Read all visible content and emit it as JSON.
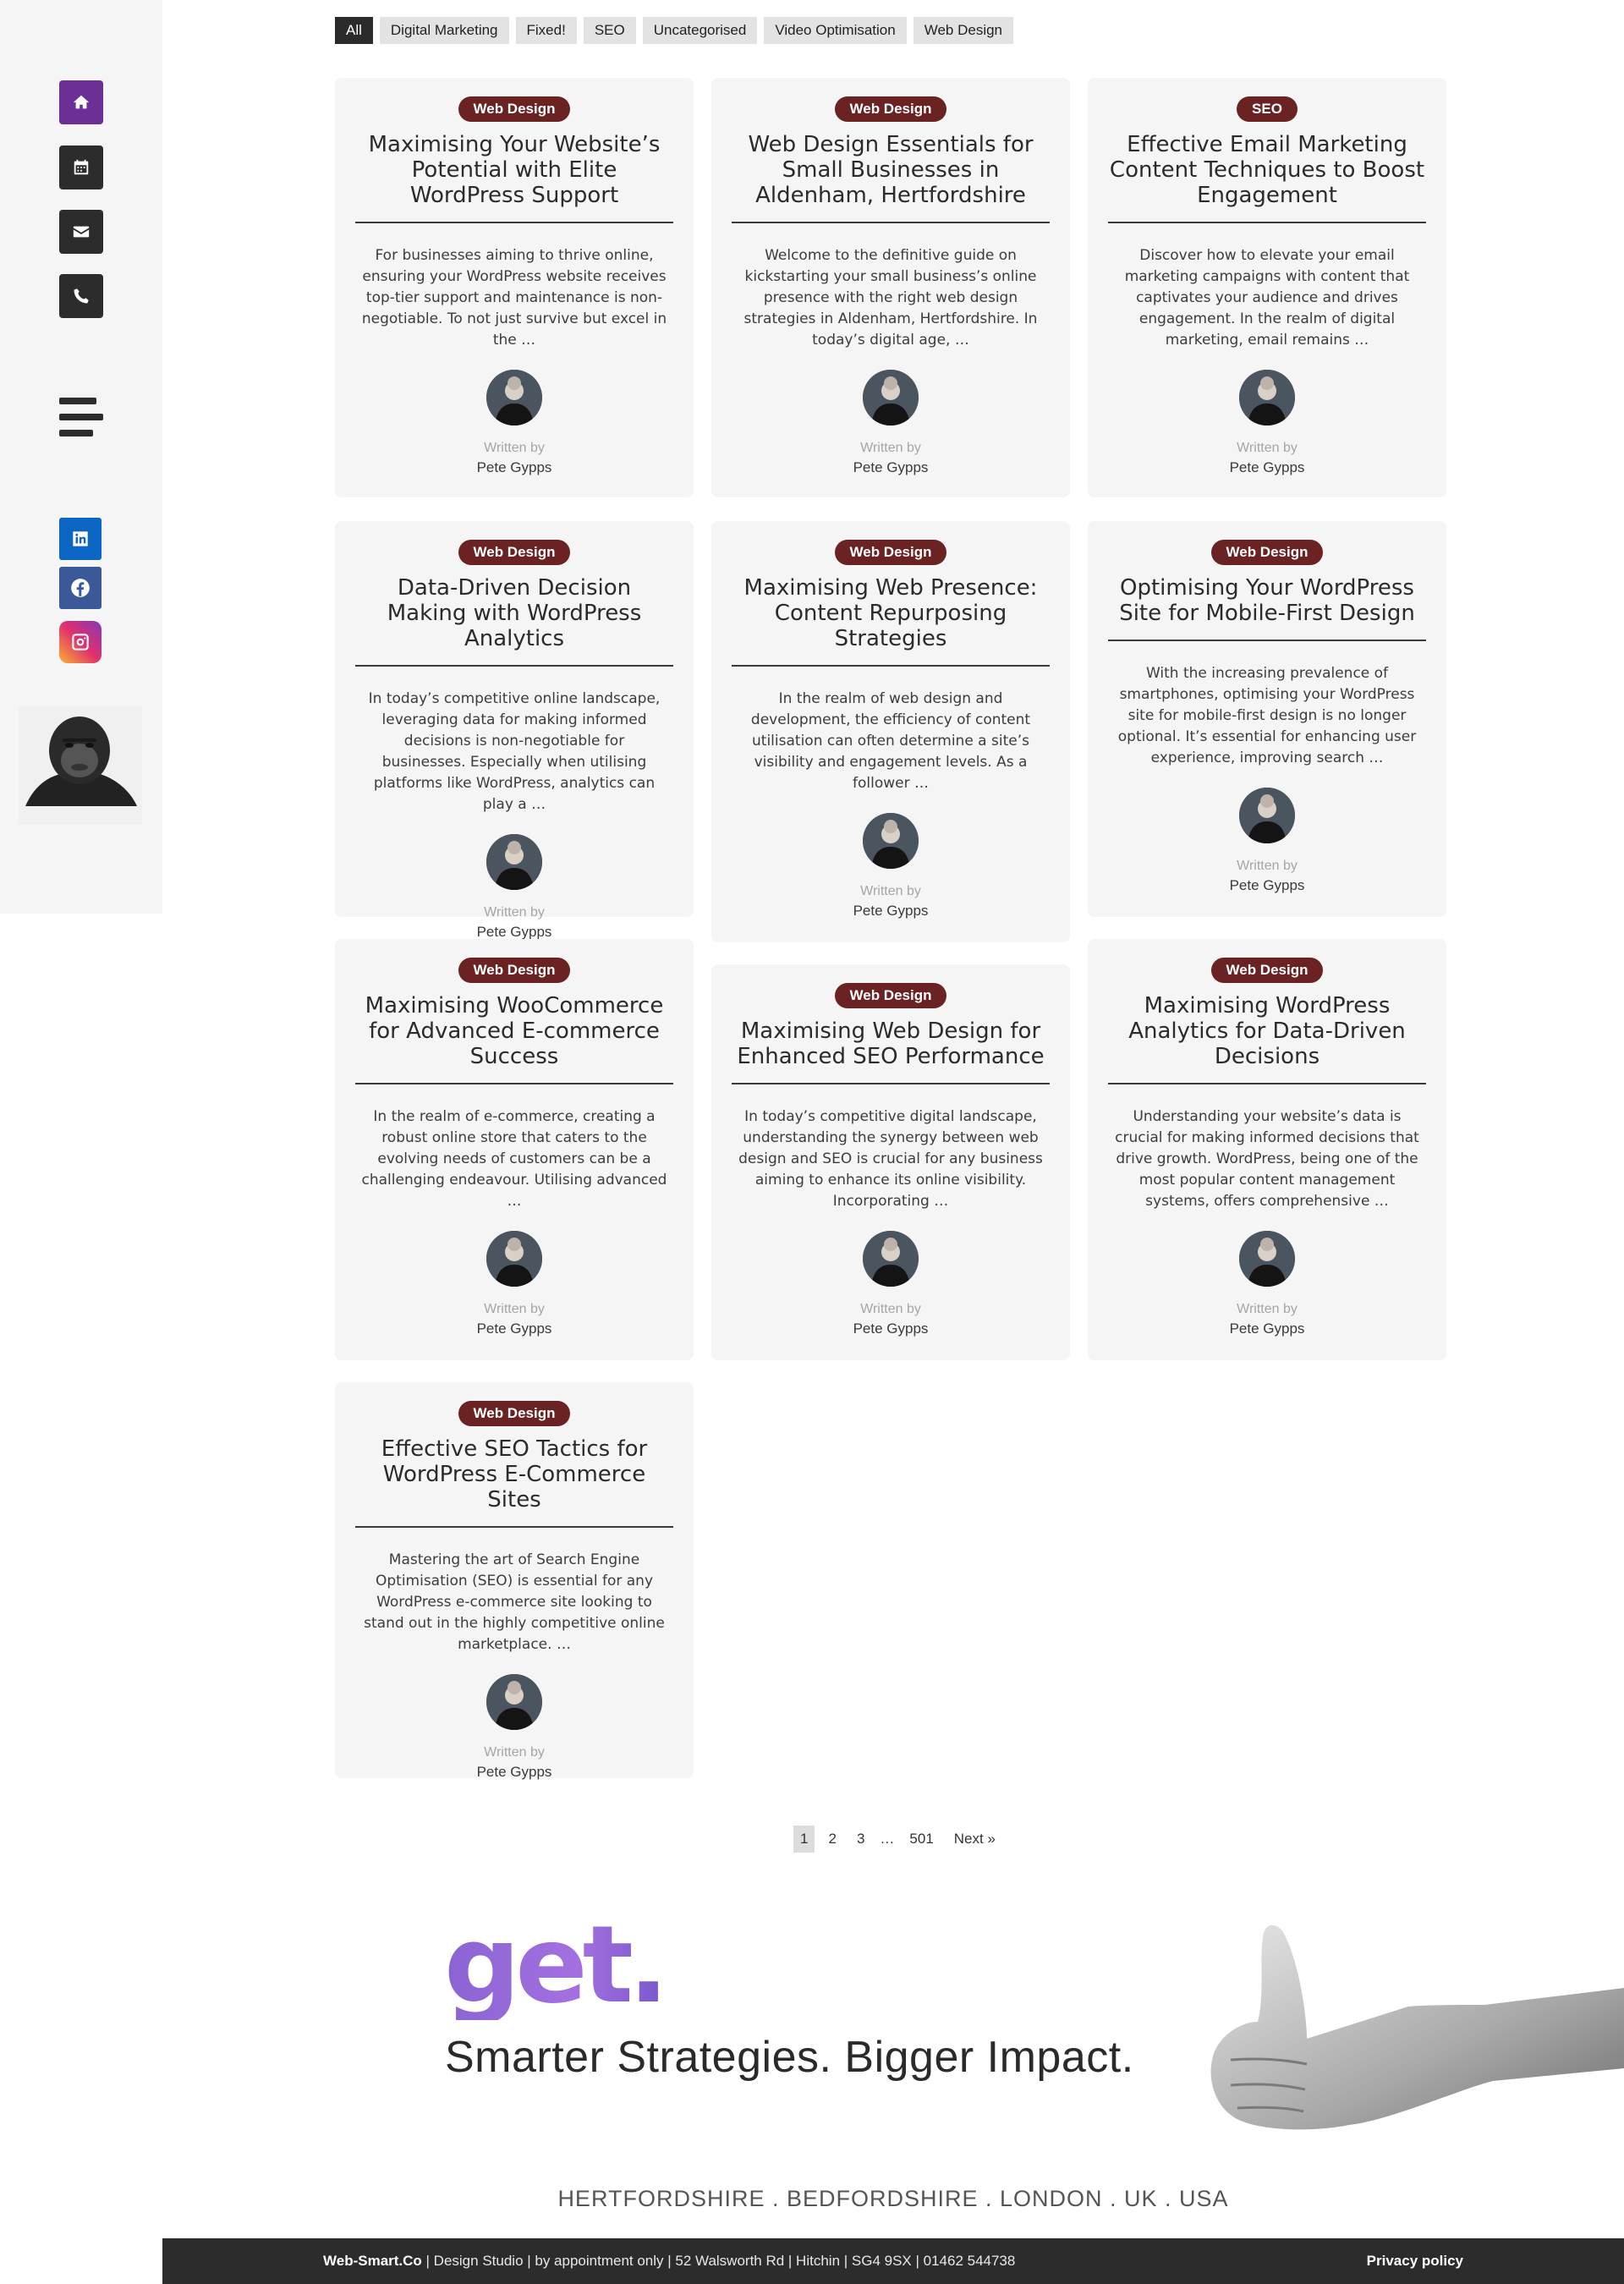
{
  "colors": {
    "home_button": "#6c2f96",
    "dark_button": "#2c2c2c",
    "linkedin": "#0a66c2",
    "facebook": "#3b5998",
    "badge": "#6a2222",
    "card_bg": "#f5f5f5",
    "footer_bg": "#2c2c2c"
  },
  "sidebar": {
    "buttons": [
      {
        "icon": "home-icon"
      },
      {
        "icon": "calendar-icon"
      },
      {
        "icon": "envelope-icon"
      },
      {
        "icon": "phone-icon"
      }
    ],
    "menu_icon": "hamburger-icon",
    "social": [
      {
        "icon": "linkedin-icon"
      },
      {
        "icon": "facebook-icon"
      },
      {
        "icon": "instagram-icon"
      }
    ],
    "mascot": "gorilla-mascot-image"
  },
  "filters": [
    "All",
    "Digital Marketing",
    "Fixed!",
    "SEO",
    "Uncategorised",
    "Video Optimisation",
    "Web Design"
  ],
  "written_by": "Written by",
  "posts": [
    {
      "category": "Web Design",
      "title": "Maximising Your Website’s Potential with Elite WordPress Support",
      "excerpt": "For businesses aiming to thrive online, ensuring your WordPress website receives top-tier support and maintenance is non-negotiable. To not just survive but excel in the …",
      "author": "Pete Gypps"
    },
    {
      "category": "Web Design",
      "title": "Web Design Essentials for Small Businesses in Aldenham, Hertfordshire",
      "excerpt": "Welcome to the definitive guide on kickstarting your small business’s online presence with the right web design strategies in Aldenham, Hertfordshire. In today’s digital age, …",
      "author": "Pete Gypps"
    },
    {
      "category": "SEO",
      "title": "Effective Email Marketing Content Techniques to Boost Engagement",
      "excerpt": "Discover how to elevate your email marketing campaigns with content that captivates your audience and drives engagement. In the realm of digital marketing, email remains …",
      "author": "Pete Gypps"
    },
    {
      "category": "Web Design",
      "title": "Data-Driven Decision Making with WordPress Analytics",
      "excerpt": "In today’s competitive online landscape, leveraging data for making informed decisions is non-negotiable for businesses. Especially when utilising platforms like WordPress, analytics can play a …",
      "author": "Pete Gypps"
    },
    {
      "category": "Web Design",
      "title": "Maximising Web Presence: Content Repurposing Strategies",
      "excerpt": "In the realm of web design and development, the efficiency of content utilisation can often determine a site’s visibility and engagement levels. As a follower …",
      "author": "Pete Gypps"
    },
    {
      "category": "Web Design",
      "title": "Optimising Your WordPress Site for Mobile-First Design",
      "excerpt": "With the increasing prevalence of smartphones, optimising your WordPress site for mobile-first design is no longer optional. It’s essential for enhancing user experience, improving search …",
      "author": "Pete Gypps"
    },
    {
      "category": "Web Design",
      "title": "Maximising WooCommerce for Advanced E-commerce Success",
      "excerpt": "In the realm of e-commerce, creating a robust online store that caters to the evolving needs of customers can be a challenging endeavour. Utilising advanced …",
      "author": "Pete Gypps"
    },
    {
      "category": "Web Design",
      "title": "Maximising Web Design for Enhanced SEO Performance",
      "excerpt": "In today’s competitive digital landscape, understanding the synergy between web design and SEO is crucial for any business aiming to enhance its online visibility. Incorporating …",
      "author": "Pete Gypps"
    },
    {
      "category": "Web Design",
      "title": "Maximising WordPress Analytics for Data-Driven Decisions",
      "excerpt": "Understanding your website’s data is crucial for making informed decisions that drive growth. WordPress, being one of the most popular content management systems, offers comprehensive …",
      "author": "Pete Gypps"
    },
    {
      "category": "Web Design",
      "title": "Effective SEO Tactics for WordPress E-Commerce Sites",
      "excerpt": "Mastering the art of Search Engine Optimisation (SEO) is essential for any WordPress e-commerce site looking to stand out in the highly competitive online marketplace. …",
      "author": "Pete Gypps"
    }
  ],
  "pagination": {
    "pages": [
      "1",
      "2",
      "3"
    ],
    "ellipsis": "…",
    "last": "501",
    "next": "Next »",
    "current": "1"
  },
  "banner": {
    "word": "get.",
    "tagline": "Smarter Strategies. Bigger Impact.",
    "regions": "HERTFORDSHIRE . BEDFORDSHIRE . LONDON . UK . USA",
    "image": "thumbs-up-hand-image"
  },
  "footer": {
    "brand": "Web-Smart.Co",
    "details": " | Design Studio | by appointment only | 52 Walsworth Rd | Hitchin | SG4 9SX | 01462 544738",
    "privacy": "Privacy policy"
  }
}
